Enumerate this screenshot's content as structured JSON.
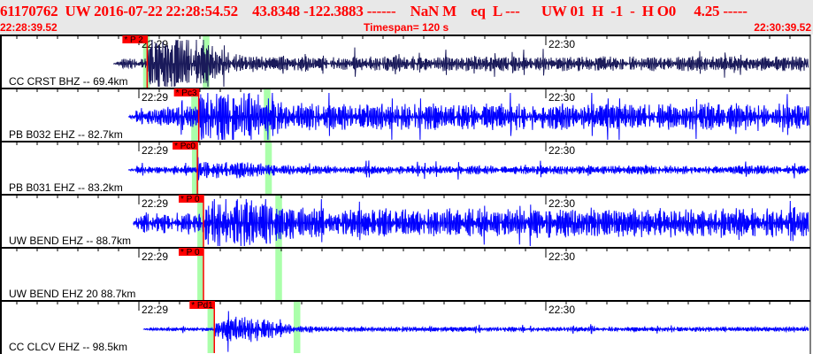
{
  "header": {
    "title": "61170762  UW 2016-07-22 22:28:54.52    43.8348 -122.3883 ------    NaN M    eq  L ---      UW 01  H  -1  -  H O0     4.25 -----",
    "start_time": "22:28:39.52",
    "timespan": "Timespan= 120 s",
    "end_time": "22:30:39.52"
  },
  "time_ticks": [
    "22:29",
    "22:30"
  ],
  "colors": {
    "header_bg": "#e8e8e8",
    "text_red": "#ff0000",
    "pick": "#ff0000",
    "window": "#aaffaa",
    "trace_first": "#1a1a5a",
    "trace": "#0000ff"
  },
  "channels": [
    {
      "label": "CC CRST BHZ -- 69.4km",
      "pick": "* P 2",
      "pick_time_s": 21.7,
      "windows_s": [
        21.1,
        29.9
      ],
      "trace_start_s": 16.7,
      "amp": 0.25,
      "burst": 4
    },
    {
      "label": "PB B032 EHZ -- 82.7km",
      "pick": "* Pc3",
      "pick_time_s": 29.3,
      "windows_s": [
        28.2,
        38.9
      ],
      "trace_start_s": 18.9,
      "amp": 0.45,
      "burst": 1.6
    },
    {
      "label": "PB B031 EHZ -- 83.2km",
      "pick": "* Pc0",
      "pick_time_s": 29.1,
      "windows_s": [
        28.3,
        39.1
      ],
      "trace_start_s": 18.9,
      "amp": 0.15,
      "burst": 1.3
    },
    {
      "label": "UW BEND EHZ -- 88.7km",
      "pick": "* P 0",
      "pick_time_s": 30.0,
      "windows_s": [
        29.1,
        40.6
      ],
      "trace_start_s": 19.6,
      "amp": 0.5,
      "burst": 1.2
    },
    {
      "label": "UW BEND EHZ 20 88.7km",
      "pick": "* P 0",
      "pick_time_s": 30.0,
      "windows_s": [
        29.1,
        40.6
      ],
      "trace_start_s": null,
      "amp": 0,
      "burst": 0
    },
    {
      "label": "CC CLCV EHZ -- 98.5km",
      "pick": "* Pd1",
      "pick_time_s": 31.6,
      "windows_s": [
        30.6,
        43.3
      ],
      "trace_start_s": 21.1,
      "amp": 0.08,
      "burst": 6
    }
  ]
}
